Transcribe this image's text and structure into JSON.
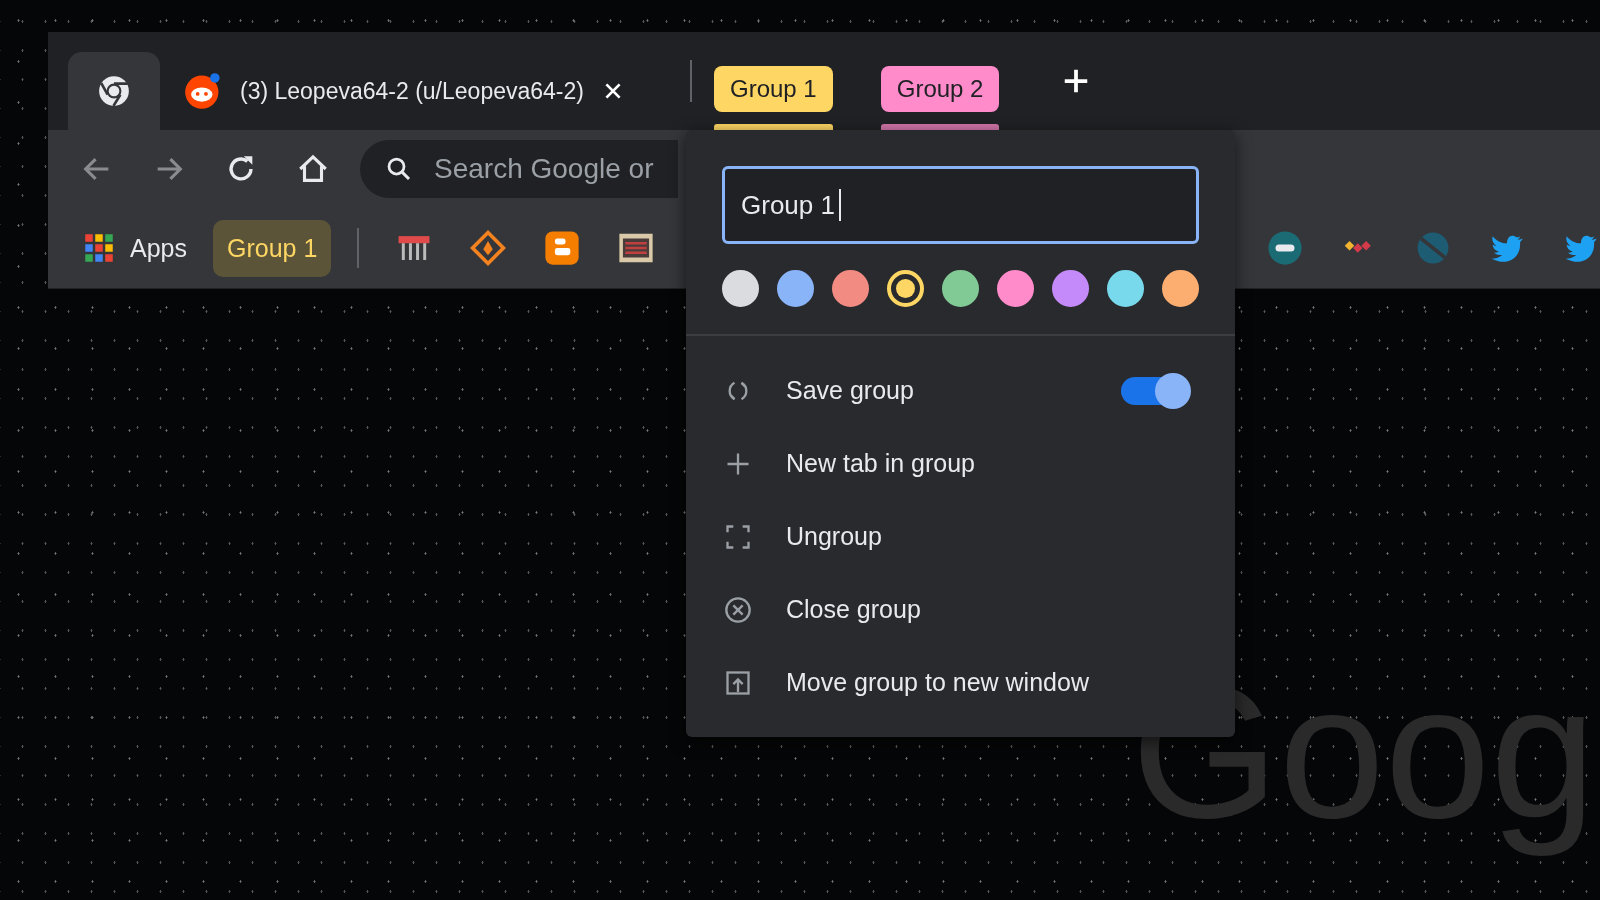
{
  "tab_strip": {
    "tabs": [
      {
        "kind": "pinned",
        "selected": true
      },
      {
        "kind": "page",
        "title": "(3) Leopeva64-2 (u/Leopeva64-2)",
        "selected": false
      }
    ],
    "groups": [
      {
        "label": "Group 1",
        "color": "#fdd663",
        "selected": true
      },
      {
        "label": "Group 2",
        "color": "#ff8bcb",
        "selected": false
      }
    ]
  },
  "omnibox": {
    "placeholder": "Search Google or"
  },
  "bookmarks_bar": {
    "apps_label": "Apps",
    "group_chip": {
      "label": "Group 1"
    }
  },
  "group_editor": {
    "name_value": "Group 1",
    "colors": [
      {
        "color": "#dadce0",
        "selected": false
      },
      {
        "color": "#8ab4f8",
        "selected": false
      },
      {
        "color": "#f28b82",
        "selected": false
      },
      {
        "color": "#fdd663",
        "selected": true
      },
      {
        "color": "#81c995",
        "selected": false
      },
      {
        "color": "#ff8bcb",
        "selected": false
      },
      {
        "color": "#c58af9",
        "selected": false
      },
      {
        "color": "#78d9ec",
        "selected": false
      },
      {
        "color": "#fcad70",
        "selected": false
      }
    ],
    "items": [
      {
        "label": "Save group",
        "kind": "toggle",
        "on": true
      },
      {
        "label": "New tab in group",
        "kind": "action"
      },
      {
        "label": "Ungroup",
        "kind": "action"
      },
      {
        "label": "Close group",
        "kind": "action"
      },
      {
        "label": "Move group to new window",
        "kind": "action"
      }
    ]
  },
  "page_logo": "Goog"
}
